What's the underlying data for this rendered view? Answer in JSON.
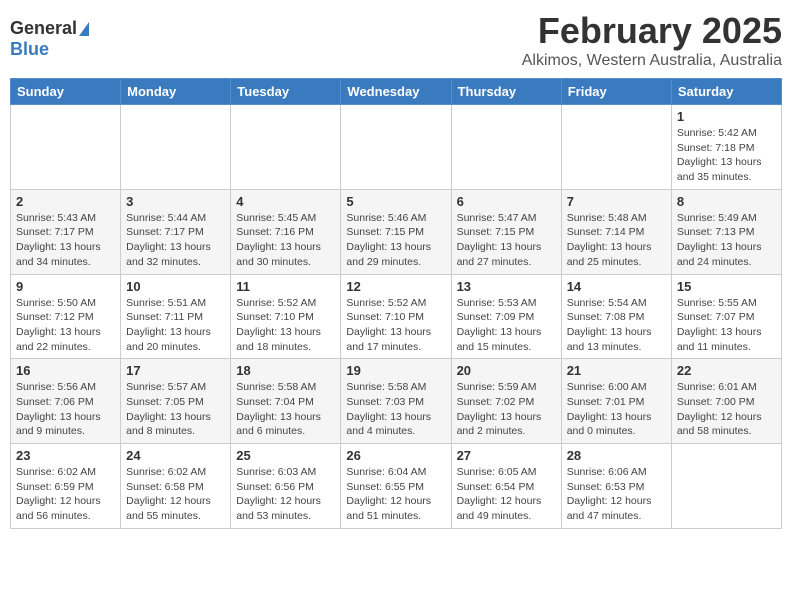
{
  "header": {
    "logo_general": "General",
    "logo_blue": "Blue",
    "month_title": "February 2025",
    "location": "Alkimos, Western Australia, Australia"
  },
  "days_of_week": [
    "Sunday",
    "Monday",
    "Tuesday",
    "Wednesday",
    "Thursday",
    "Friday",
    "Saturday"
  ],
  "weeks": [
    [
      {
        "day": "",
        "detail": ""
      },
      {
        "day": "",
        "detail": ""
      },
      {
        "day": "",
        "detail": ""
      },
      {
        "day": "",
        "detail": ""
      },
      {
        "day": "",
        "detail": ""
      },
      {
        "day": "",
        "detail": ""
      },
      {
        "day": "1",
        "detail": "Sunrise: 5:42 AM\nSunset: 7:18 PM\nDaylight: 13 hours\nand 35 minutes."
      }
    ],
    [
      {
        "day": "2",
        "detail": "Sunrise: 5:43 AM\nSunset: 7:17 PM\nDaylight: 13 hours\nand 34 minutes."
      },
      {
        "day": "3",
        "detail": "Sunrise: 5:44 AM\nSunset: 7:17 PM\nDaylight: 13 hours\nand 32 minutes."
      },
      {
        "day": "4",
        "detail": "Sunrise: 5:45 AM\nSunset: 7:16 PM\nDaylight: 13 hours\nand 30 minutes."
      },
      {
        "day": "5",
        "detail": "Sunrise: 5:46 AM\nSunset: 7:15 PM\nDaylight: 13 hours\nand 29 minutes."
      },
      {
        "day": "6",
        "detail": "Sunrise: 5:47 AM\nSunset: 7:15 PM\nDaylight: 13 hours\nand 27 minutes."
      },
      {
        "day": "7",
        "detail": "Sunrise: 5:48 AM\nSunset: 7:14 PM\nDaylight: 13 hours\nand 25 minutes."
      },
      {
        "day": "8",
        "detail": "Sunrise: 5:49 AM\nSunset: 7:13 PM\nDaylight: 13 hours\nand 24 minutes."
      }
    ],
    [
      {
        "day": "9",
        "detail": "Sunrise: 5:50 AM\nSunset: 7:12 PM\nDaylight: 13 hours\nand 22 minutes."
      },
      {
        "day": "10",
        "detail": "Sunrise: 5:51 AM\nSunset: 7:11 PM\nDaylight: 13 hours\nand 20 minutes."
      },
      {
        "day": "11",
        "detail": "Sunrise: 5:52 AM\nSunset: 7:10 PM\nDaylight: 13 hours\nand 18 minutes."
      },
      {
        "day": "12",
        "detail": "Sunrise: 5:52 AM\nSunset: 7:10 PM\nDaylight: 13 hours\nand 17 minutes."
      },
      {
        "day": "13",
        "detail": "Sunrise: 5:53 AM\nSunset: 7:09 PM\nDaylight: 13 hours\nand 15 minutes."
      },
      {
        "day": "14",
        "detail": "Sunrise: 5:54 AM\nSunset: 7:08 PM\nDaylight: 13 hours\nand 13 minutes."
      },
      {
        "day": "15",
        "detail": "Sunrise: 5:55 AM\nSunset: 7:07 PM\nDaylight: 13 hours\nand 11 minutes."
      }
    ],
    [
      {
        "day": "16",
        "detail": "Sunrise: 5:56 AM\nSunset: 7:06 PM\nDaylight: 13 hours\nand 9 minutes."
      },
      {
        "day": "17",
        "detail": "Sunrise: 5:57 AM\nSunset: 7:05 PM\nDaylight: 13 hours\nand 8 minutes."
      },
      {
        "day": "18",
        "detail": "Sunrise: 5:58 AM\nSunset: 7:04 PM\nDaylight: 13 hours\nand 6 minutes."
      },
      {
        "day": "19",
        "detail": "Sunrise: 5:58 AM\nSunset: 7:03 PM\nDaylight: 13 hours\nand 4 minutes."
      },
      {
        "day": "20",
        "detail": "Sunrise: 5:59 AM\nSunset: 7:02 PM\nDaylight: 13 hours\nand 2 minutes."
      },
      {
        "day": "21",
        "detail": "Sunrise: 6:00 AM\nSunset: 7:01 PM\nDaylight: 13 hours\nand 0 minutes."
      },
      {
        "day": "22",
        "detail": "Sunrise: 6:01 AM\nSunset: 7:00 PM\nDaylight: 12 hours\nand 58 minutes."
      }
    ],
    [
      {
        "day": "23",
        "detail": "Sunrise: 6:02 AM\nSunset: 6:59 PM\nDaylight: 12 hours\nand 56 minutes."
      },
      {
        "day": "24",
        "detail": "Sunrise: 6:02 AM\nSunset: 6:58 PM\nDaylight: 12 hours\nand 55 minutes."
      },
      {
        "day": "25",
        "detail": "Sunrise: 6:03 AM\nSunset: 6:56 PM\nDaylight: 12 hours\nand 53 minutes."
      },
      {
        "day": "26",
        "detail": "Sunrise: 6:04 AM\nSunset: 6:55 PM\nDaylight: 12 hours\nand 51 minutes."
      },
      {
        "day": "27",
        "detail": "Sunrise: 6:05 AM\nSunset: 6:54 PM\nDaylight: 12 hours\nand 49 minutes."
      },
      {
        "day": "28",
        "detail": "Sunrise: 6:06 AM\nSunset: 6:53 PM\nDaylight: 12 hours\nand 47 minutes."
      },
      {
        "day": "",
        "detail": ""
      }
    ]
  ]
}
